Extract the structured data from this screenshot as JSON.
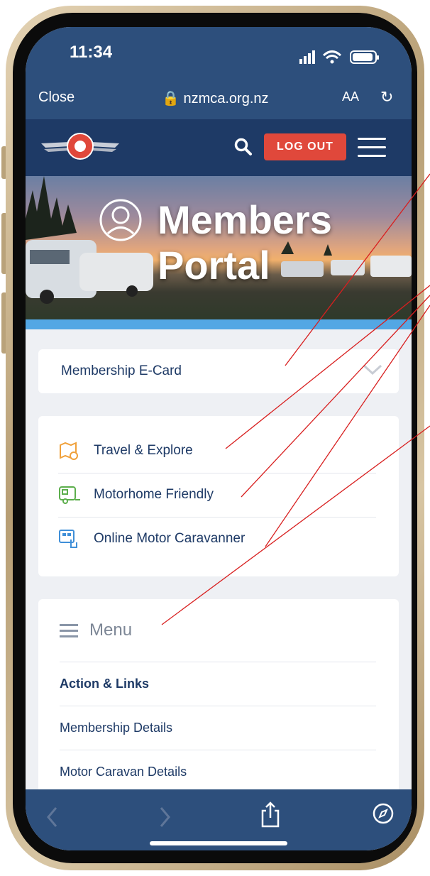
{
  "status_bar": {
    "time": "11:34"
  },
  "url_bar": {
    "close_label": "Close",
    "domain": "nzmca.org.nz",
    "text_size_label": "AA"
  },
  "site_header": {
    "logout_label": "LOG OUT"
  },
  "hero": {
    "line1": "Members",
    "line2": "Portal"
  },
  "ecard": {
    "label": "Membership E-Card"
  },
  "quick_links": [
    {
      "label": "Travel & Explore",
      "icon": "map-pin-icon",
      "color": "#f0a13b"
    },
    {
      "label": "Motorhome Friendly",
      "icon": "caravan-icon",
      "color": "#5cae4c"
    },
    {
      "label": "Online Motor Caravanner",
      "icon": "magazine-touch-icon",
      "color": "#3f8fd8"
    }
  ],
  "menu": {
    "title": "Menu",
    "items": [
      {
        "label": "Action & Links"
      },
      {
        "label": "Membership Details"
      },
      {
        "label": "Motor Caravan Details"
      }
    ]
  },
  "colors": {
    "navy": "#1e3a66",
    "safari_blue": "#2d4f7c",
    "logout_red": "#e0483b",
    "accent_blue": "#53a7e4",
    "annotation_red": "#d81f1f"
  }
}
